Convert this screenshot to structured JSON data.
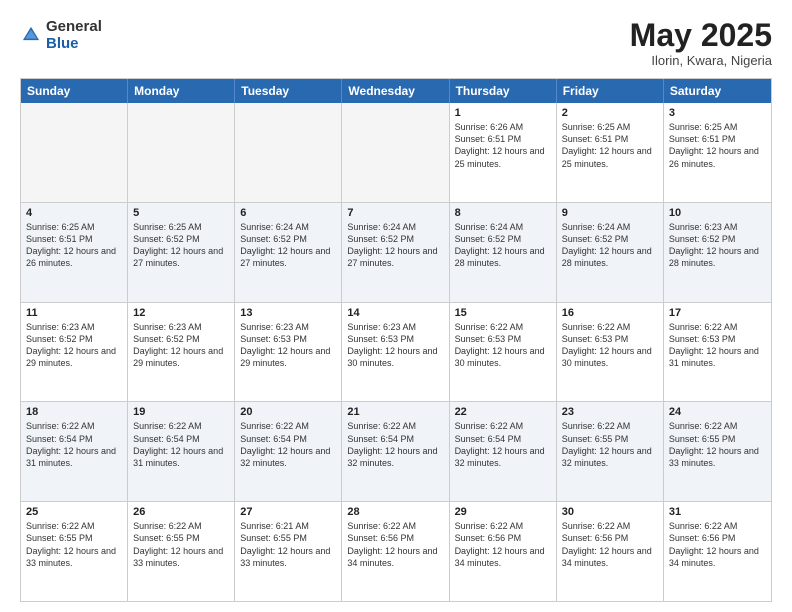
{
  "header": {
    "logo_general": "General",
    "logo_blue": "Blue",
    "month_title": "May 2025",
    "location": "Ilorin, Kwara, Nigeria"
  },
  "days_of_week": [
    "Sunday",
    "Monday",
    "Tuesday",
    "Wednesday",
    "Thursday",
    "Friday",
    "Saturday"
  ],
  "weeks": [
    [
      {
        "day": "",
        "empty": true
      },
      {
        "day": "",
        "empty": true
      },
      {
        "day": "",
        "empty": true
      },
      {
        "day": "",
        "empty": true
      },
      {
        "day": "1",
        "sunrise": "6:26 AM",
        "sunset": "6:51 PM",
        "daylight": "12 hours and 25 minutes."
      },
      {
        "day": "2",
        "sunrise": "6:25 AM",
        "sunset": "6:51 PM",
        "daylight": "12 hours and 25 minutes."
      },
      {
        "day": "3",
        "sunrise": "6:25 AM",
        "sunset": "6:51 PM",
        "daylight": "12 hours and 26 minutes."
      }
    ],
    [
      {
        "day": "4",
        "sunrise": "6:25 AM",
        "sunset": "6:51 PM",
        "daylight": "12 hours and 26 minutes."
      },
      {
        "day": "5",
        "sunrise": "6:25 AM",
        "sunset": "6:52 PM",
        "daylight": "12 hours and 27 minutes."
      },
      {
        "day": "6",
        "sunrise": "6:24 AM",
        "sunset": "6:52 PM",
        "daylight": "12 hours and 27 minutes."
      },
      {
        "day": "7",
        "sunrise": "6:24 AM",
        "sunset": "6:52 PM",
        "daylight": "12 hours and 27 minutes."
      },
      {
        "day": "8",
        "sunrise": "6:24 AM",
        "sunset": "6:52 PM",
        "daylight": "12 hours and 28 minutes."
      },
      {
        "day": "9",
        "sunrise": "6:24 AM",
        "sunset": "6:52 PM",
        "daylight": "12 hours and 28 minutes."
      },
      {
        "day": "10",
        "sunrise": "6:23 AM",
        "sunset": "6:52 PM",
        "daylight": "12 hours and 28 minutes."
      }
    ],
    [
      {
        "day": "11",
        "sunrise": "6:23 AM",
        "sunset": "6:52 PM",
        "daylight": "12 hours and 29 minutes."
      },
      {
        "day": "12",
        "sunrise": "6:23 AM",
        "sunset": "6:52 PM",
        "daylight": "12 hours and 29 minutes."
      },
      {
        "day": "13",
        "sunrise": "6:23 AM",
        "sunset": "6:53 PM",
        "daylight": "12 hours and 29 minutes."
      },
      {
        "day": "14",
        "sunrise": "6:23 AM",
        "sunset": "6:53 PM",
        "daylight": "12 hours and 30 minutes."
      },
      {
        "day": "15",
        "sunrise": "6:22 AM",
        "sunset": "6:53 PM",
        "daylight": "12 hours and 30 minutes."
      },
      {
        "day": "16",
        "sunrise": "6:22 AM",
        "sunset": "6:53 PM",
        "daylight": "12 hours and 30 minutes."
      },
      {
        "day": "17",
        "sunrise": "6:22 AM",
        "sunset": "6:53 PM",
        "daylight": "12 hours and 31 minutes."
      }
    ],
    [
      {
        "day": "18",
        "sunrise": "6:22 AM",
        "sunset": "6:54 PM",
        "daylight": "12 hours and 31 minutes."
      },
      {
        "day": "19",
        "sunrise": "6:22 AM",
        "sunset": "6:54 PM",
        "daylight": "12 hours and 31 minutes."
      },
      {
        "day": "20",
        "sunrise": "6:22 AM",
        "sunset": "6:54 PM",
        "daylight": "12 hours and 32 minutes."
      },
      {
        "day": "21",
        "sunrise": "6:22 AM",
        "sunset": "6:54 PM",
        "daylight": "12 hours and 32 minutes."
      },
      {
        "day": "22",
        "sunrise": "6:22 AM",
        "sunset": "6:54 PM",
        "daylight": "12 hours and 32 minutes."
      },
      {
        "day": "23",
        "sunrise": "6:22 AM",
        "sunset": "6:55 PM",
        "daylight": "12 hours and 32 minutes."
      },
      {
        "day": "24",
        "sunrise": "6:22 AM",
        "sunset": "6:55 PM",
        "daylight": "12 hours and 33 minutes."
      }
    ],
    [
      {
        "day": "25",
        "sunrise": "6:22 AM",
        "sunset": "6:55 PM",
        "daylight": "12 hours and 33 minutes."
      },
      {
        "day": "26",
        "sunrise": "6:22 AM",
        "sunset": "6:55 PM",
        "daylight": "12 hours and 33 minutes."
      },
      {
        "day": "27",
        "sunrise": "6:21 AM",
        "sunset": "6:55 PM",
        "daylight": "12 hours and 33 minutes."
      },
      {
        "day": "28",
        "sunrise": "6:22 AM",
        "sunset": "6:56 PM",
        "daylight": "12 hours and 34 minutes."
      },
      {
        "day": "29",
        "sunrise": "6:22 AM",
        "sunset": "6:56 PM",
        "daylight": "12 hours and 34 minutes."
      },
      {
        "day": "30",
        "sunrise": "6:22 AM",
        "sunset": "6:56 PM",
        "daylight": "12 hours and 34 minutes."
      },
      {
        "day": "31",
        "sunrise": "6:22 AM",
        "sunset": "6:56 PM",
        "daylight": "12 hours and 34 minutes."
      }
    ]
  ]
}
